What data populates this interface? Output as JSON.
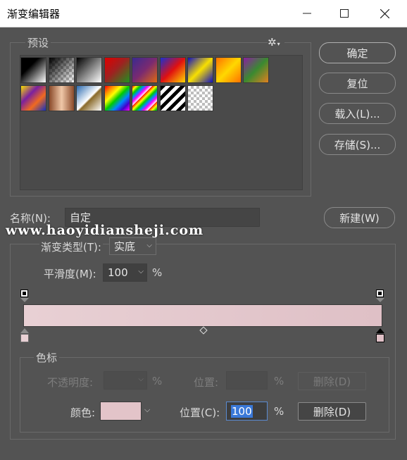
{
  "window": {
    "title": "渐变编辑器"
  },
  "presets": {
    "label": "预设",
    "swatches": [
      {
        "kind": "fg-bg",
        "bg": "linear-gradient(135deg,#000 0%,#000 35%,#fff 100%)"
      },
      {
        "kind": "fg-transparent",
        "bg": "linear-gradient(135deg,#000 0%,rgba(0,0,0,0.6) 40%,rgba(0,0,0,0) 100%)"
      },
      {
        "kind": "black-white",
        "bg": "linear-gradient(135deg,#000 0%,#fff 100%)"
      },
      {
        "kind": "red-green",
        "bg": "linear-gradient(135deg,#e00000 0%,#a02020 45%,#209020 100%)"
      },
      {
        "kind": "violet-orange",
        "bg": "linear-gradient(135deg,#3a2a90 0%,#7a2a70 50%,#e06a10 100%)"
      },
      {
        "kind": "blue-red-yellow",
        "bg": "linear-gradient(135deg,#1a30d0 0%,#e01010 50%,#ffd800 100%)"
      },
      {
        "kind": "blue-yellow-blue",
        "bg": "linear-gradient(135deg,#1010c0 0%,#f8e000 50%,#1010c0 100%)"
      },
      {
        "kind": "orange-yellow-orange",
        "bg": "linear-gradient(135deg,#ff7000 0%,#ffd800 50%,#ff7000 100%)"
      },
      {
        "kind": "violet-green-orange",
        "bg": "linear-gradient(135deg,#8a20a0 0%,#3a8a30 50%,#e08020 100%)"
      },
      {
        "kind": "yellow-violet-orange-blue",
        "bg": "linear-gradient(135deg,#f8e000 0%,#7a20a0 35%,#f06a20 65%,#1030c0 100%)"
      },
      {
        "kind": "copper",
        "bg": "linear-gradient(90deg,#8a4a2a 0%,#f0c8a8 50%,#8a4a2a 100%)"
      },
      {
        "kind": "chrome",
        "bg": "linear-gradient(135deg,#2a6ab0 0%,#ffffff 50%,#8a6a2a 55%,#fff 100%)"
      },
      {
        "kind": "spectrum",
        "bg": "linear-gradient(135deg,#ff0000,#ff8800,#ffff00,#00cc00,#0088ff,#4400cc,#ff00ff)"
      },
      {
        "kind": "transparent-rainbow",
        "bg": "repeating-linear-gradient(135deg,#ff0000 0px,#ffff00 4px,#00cc00 8px,#0088ff 12px,#ff00ff 16px,#ffffff 20px)"
      },
      {
        "kind": "transparent-stripes",
        "bg": "repeating-linear-gradient(135deg,#000 0px,#000 5px,#fff 5px,#fff 10px)"
      },
      {
        "kind": "neutral-density",
        "bg": "checker"
      }
    ],
    "settings_icon": "gear-icon"
  },
  "buttons": {
    "ok": "确定",
    "reset": "复位",
    "load": "载入(L)...",
    "save": "存储(S)...",
    "new": "新建(W)"
  },
  "name": {
    "label": "名称(N):",
    "value": "自定"
  },
  "watermark": "www.haoyidiansheji.com",
  "gradient": {
    "type_label": "渐变类型(T):",
    "type_value": "实底",
    "smooth_label": "平滑度(M):",
    "smooth_value": "100",
    "smooth_unit": "%",
    "color_start": "#e8d0d4",
    "color_end": "#dfc0c6"
  },
  "stops": {
    "group_label": "色标",
    "opacity_label": "不透明度:",
    "opacity_unit": "%",
    "opacity_position_label": "位置:",
    "opacity_position_unit": "%",
    "opacity_delete": "删除(D)",
    "color_label": "颜色:",
    "color_value": "#e3c4c9",
    "color_position_label": "位置(C):",
    "color_position_value": "100",
    "color_position_unit": "%",
    "color_delete": "删除(D)"
  }
}
